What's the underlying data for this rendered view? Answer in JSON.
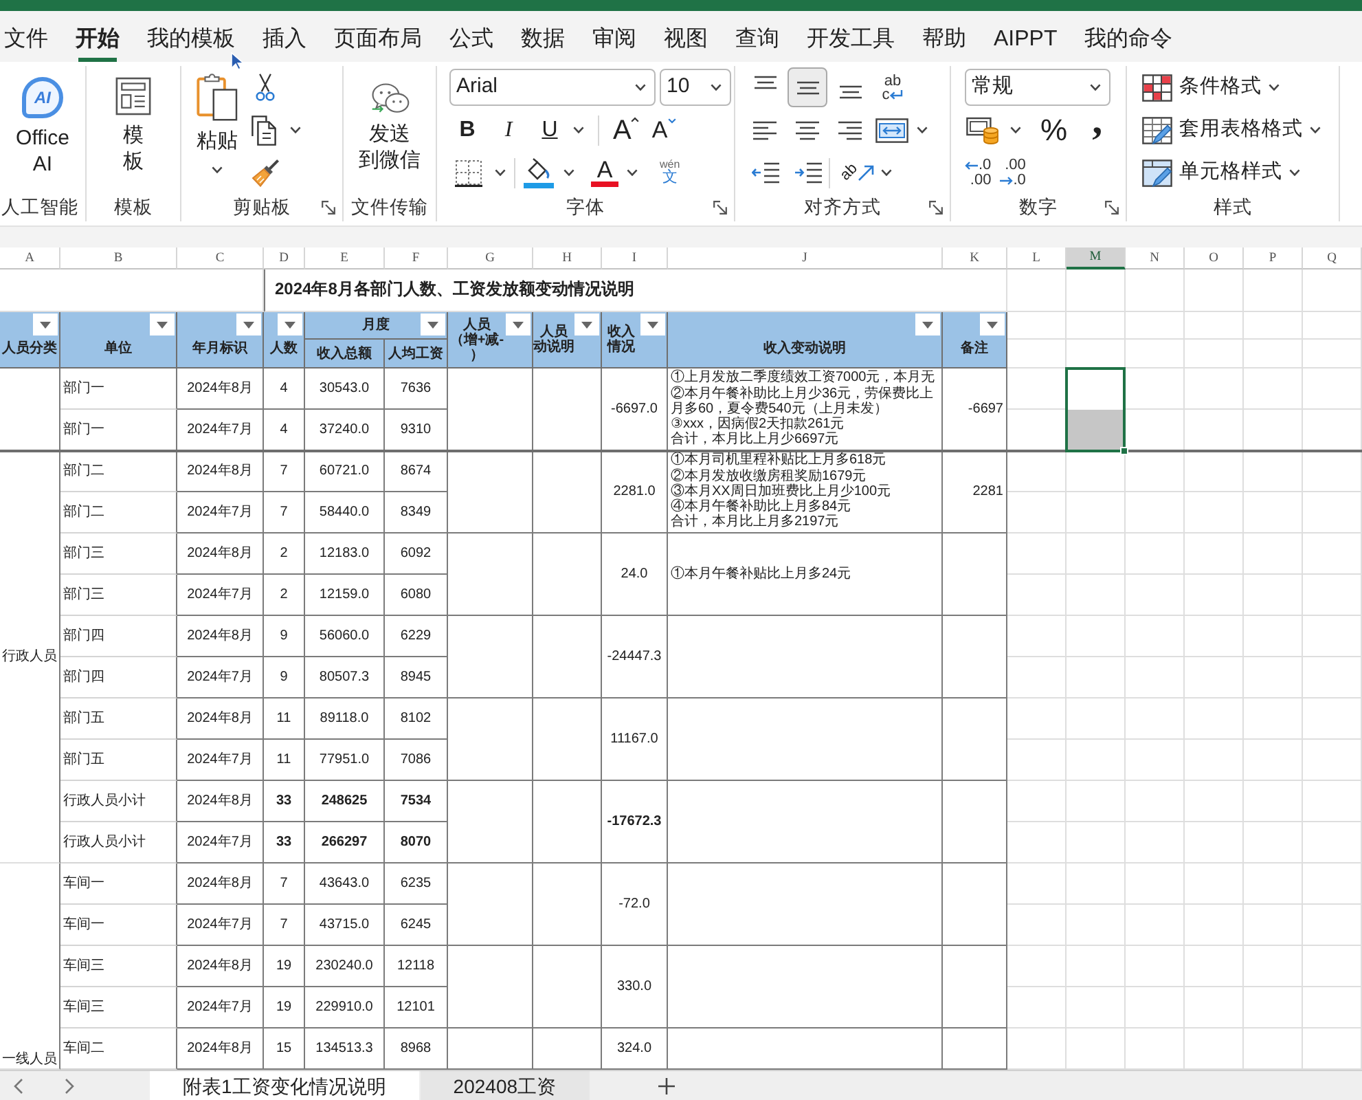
{
  "ribbon_tabs": [
    {
      "label": "文件",
      "selected": false
    },
    {
      "label": "开始",
      "selected": true
    },
    {
      "label": "我的模板",
      "selected": false
    },
    {
      "label": "插入",
      "selected": false
    },
    {
      "label": "页面布局",
      "selected": false
    },
    {
      "label": "公式",
      "selected": false
    },
    {
      "label": "数据",
      "selected": false
    },
    {
      "label": "审阅",
      "selected": false
    },
    {
      "label": "视图",
      "selected": false
    },
    {
      "label": "查询",
      "selected": false
    },
    {
      "label": "开发工具",
      "selected": false
    },
    {
      "label": "帮助",
      "selected": false
    },
    {
      "label": "AIPPT",
      "selected": false
    },
    {
      "label": "我的命令",
      "selected": false
    }
  ],
  "ribbon_groups": [
    {
      "kind": "ai",
      "label": "人工智能",
      "launcher": false,
      "logo_text": "AI",
      "button_lines": [
        "Office",
        "AI"
      ]
    },
    {
      "kind": "template",
      "label": "模板",
      "launcher": false,
      "button_lines": [
        "模",
        "板"
      ]
    },
    {
      "kind": "clipboard",
      "label": "剪贴板",
      "launcher": true,
      "button_lines": [
        "粘贴"
      ]
    },
    {
      "kind": "transfer",
      "label": "文件传输",
      "launcher": false,
      "button_lines": [
        "发送",
        "到微信"
      ]
    },
    {
      "kind": "font",
      "label": "字体",
      "launcher": true,
      "font_name": "Arial",
      "font_size": "10",
      "bold": "B",
      "italic": "I",
      "underline": "U",
      "grow_font": "A",
      "shrink_font": "A",
      "font_color": "A",
      "phonetic": [
        "wén",
        "文"
      ]
    },
    {
      "kind": "alignment",
      "label": "对齐方式",
      "launcher": true,
      "vertical_align": [
        {
          "kind": "top",
          "selected": false
        },
        {
          "kind": "middle",
          "selected": true
        },
        {
          "kind": "bottom",
          "selected": false
        }
      ],
      "wrap_text": [
        "ab",
        "c"
      ],
      "horizontal_align": [
        {
          "kind": "left",
          "selected": false
        },
        {
          "kind": "center",
          "selected": false
        },
        {
          "kind": "right",
          "selected": false
        }
      ],
      "orientation_text": "ab"
    },
    {
      "kind": "number",
      "label": "数字",
      "launcher": true,
      "format": "常规",
      "percent": "%",
      "comma": ",",
      "increase_decimal": [
        ".0",
        ".00"
      ],
      "decrease_decimal": [
        ".00",
        ".0"
      ]
    },
    {
      "kind": "styles",
      "label": "样式",
      "launcher": false,
      "commands": [
        {
          "kind": "conditional",
          "label": "条件格式"
        },
        {
          "kind": "table",
          "label": "套用表格格式"
        },
        {
          "kind": "cell",
          "label": "单元格样式"
        }
      ]
    }
  ],
  "columns": [
    {
      "letter": "A",
      "selected": false
    },
    {
      "letter": "B",
      "selected": false
    },
    {
      "letter": "C",
      "selected": false
    },
    {
      "letter": "D",
      "selected": false
    },
    {
      "letter": "E",
      "selected": false
    },
    {
      "letter": "F",
      "selected": false
    },
    {
      "letter": "G",
      "selected": false
    },
    {
      "letter": "H",
      "selected": false
    },
    {
      "letter": "I",
      "selected": false
    },
    {
      "letter": "J",
      "selected": false
    },
    {
      "letter": "K",
      "selected": false
    },
    {
      "letter": "L",
      "selected": false
    },
    {
      "letter": "M",
      "selected": true
    },
    {
      "letter": "N",
      "selected": false
    },
    {
      "letter": "O",
      "selected": false
    },
    {
      "letter": "P",
      "selected": false
    },
    {
      "letter": "Q",
      "selected": false
    }
  ],
  "title": "2024年8月各部门人数、工资发放额变动情况说明",
  "headers": [
    {
      "lines": [
        "人员分类"
      ],
      "filter_button": true
    },
    {
      "lines": [
        "单位"
      ],
      "filter_button": true
    },
    {
      "lines": [
        "年月标识"
      ],
      "filter_button": true
    },
    {
      "lines": [
        "人数"
      ],
      "filter_button": true
    },
    {
      "lines": [
        "月度"
      ],
      "filter_button": true,
      "subheaders": [
        "收入总额",
        "人均工资"
      ]
    },
    {
      "lines": [
        "人员",
        "（增+减-",
        "）"
      ],
      "filter_button": true
    },
    {
      "lines": [
        "人员",
        "动说明"
      ],
      "filter_button": true
    },
    {
      "lines": [
        "收入",
        "情况"
      ],
      "filter_button": true
    },
    {
      "lines": [
        "收入变动说明"
      ],
      "filter_button": true
    },
    {
      "lines": [
        "备注"
      ],
      "filter_button": true
    }
  ],
  "sections": [
    {
      "pairs": [
        {
          "subtotal": false,
          "records": [
            {
              "unit": "部门一",
              "period": "2024年8月",
              "headcount": "4",
              "total_income": "30543.0",
              "average_wage": "7636"
            },
            {
              "unit": "部门一",
              "period": "2024年7月",
              "headcount": "4",
              "total_income": "37240.0",
              "average_wage": "9310"
            }
          ],
          "income_change": "-6697.0",
          "explanation": [
            "①上月发放二季度绩效工资7000元，本月无",
            "②本月午餐补助比上月少36元，劳保费比上",
            "月多60，夏令费540元（上月未发）",
            "③xxx，因病假2天扣款261元",
            "合计，本月比上月少6697元"
          ],
          "remarks": "-6697"
        }
      ]
    },
    {
      "category": "行政人员",
      "pairs": [
        {
          "subtotal": false,
          "records": [
            {
              "unit": "部门二",
              "period": "2024年8月",
              "headcount": "7",
              "total_income": "60721.0",
              "average_wage": "8674"
            },
            {
              "unit": "部门二",
              "period": "2024年7月",
              "headcount": "7",
              "total_income": "58440.0",
              "average_wage": "8349"
            }
          ],
          "income_change": "2281.0",
          "explanation": [
            "①本月司机里程补贴比上月多618元",
            "②本月发放收缴房租奖励1679元",
            "③本月XX周日加班费比上月少100元",
            "④本月午餐补助比上月多84元",
            "合计，本月比上月多2197元"
          ],
          "remarks": "2281"
        },
        {
          "subtotal": false,
          "records": [
            {
              "unit": "部门三",
              "period": "2024年8月",
              "headcount": "2",
              "total_income": "12183.0",
              "average_wage": "6092"
            },
            {
              "unit": "部门三",
              "period": "2024年7月",
              "headcount": "2",
              "total_income": "12159.0",
              "average_wage": "6080"
            }
          ],
          "income_change": "24.0",
          "explanation": [
            "①本月午餐补贴比上月多24元"
          ]
        },
        {
          "subtotal": false,
          "records": [
            {
              "unit": "部门四",
              "period": "2024年8月",
              "headcount": "9",
              "total_income": "56060.0",
              "average_wage": "6229"
            },
            {
              "unit": "部门四",
              "period": "2024年7月",
              "headcount": "9",
              "total_income": "80507.3",
              "average_wage": "8945"
            }
          ],
          "income_change": "-24447.3"
        },
        {
          "subtotal": false,
          "records": [
            {
              "unit": "部门五",
              "period": "2024年8月",
              "headcount": "11",
              "total_income": "89118.0",
              "average_wage": "8102"
            },
            {
              "unit": "部门五",
              "period": "2024年7月",
              "headcount": "11",
              "total_income": "77951.0",
              "average_wage": "7086"
            }
          ],
          "income_change": "11167.0"
        },
        {
          "subtotal": true,
          "records": [
            {
              "unit": "行政人员小计",
              "period": "2024年8月",
              "headcount": "33",
              "total_income": "248625",
              "average_wage": "7534"
            },
            {
              "unit": "行政人员小计",
              "period": "2024年7月",
              "headcount": "33",
              "total_income": "266297",
              "average_wage": "8070"
            }
          ],
          "income_change": "-17672.3"
        }
      ]
    },
    {
      "category": "一线人员",
      "pairs": [
        {
          "subtotal": false,
          "records": [
            {
              "unit": "车间一",
              "period": "2024年8月",
              "headcount": "7",
              "total_income": "43643.0",
              "average_wage": "6235"
            },
            {
              "unit": "车间一",
              "period": "2024年7月",
              "headcount": "7",
              "total_income": "43715.0",
              "average_wage": "6245"
            }
          ],
          "income_change": "-72.0"
        },
        {
          "subtotal": false,
          "records": [
            {
              "unit": "车间三",
              "period": "2024年8月",
              "headcount": "19",
              "total_income": "230240.0",
              "average_wage": "12118"
            },
            {
              "unit": "车间三",
              "period": "2024年7月",
              "headcount": "19",
              "total_income": "229910.0",
              "average_wage": "12101"
            }
          ],
          "income_change": "330.0"
        },
        {
          "subtotal": false,
          "records": [
            {
              "unit": "车间二",
              "period": "2024年8月",
              "headcount": "15",
              "total_income": "134513.3",
              "average_wage": "8968"
            }
          ],
          "income_change": "324.0"
        }
      ]
    }
  ],
  "sheet_tabs": [
    {
      "label": "附表1工资变化情况说明",
      "selected": true
    },
    {
      "label": "202408工资",
      "selected": false
    }
  ]
}
